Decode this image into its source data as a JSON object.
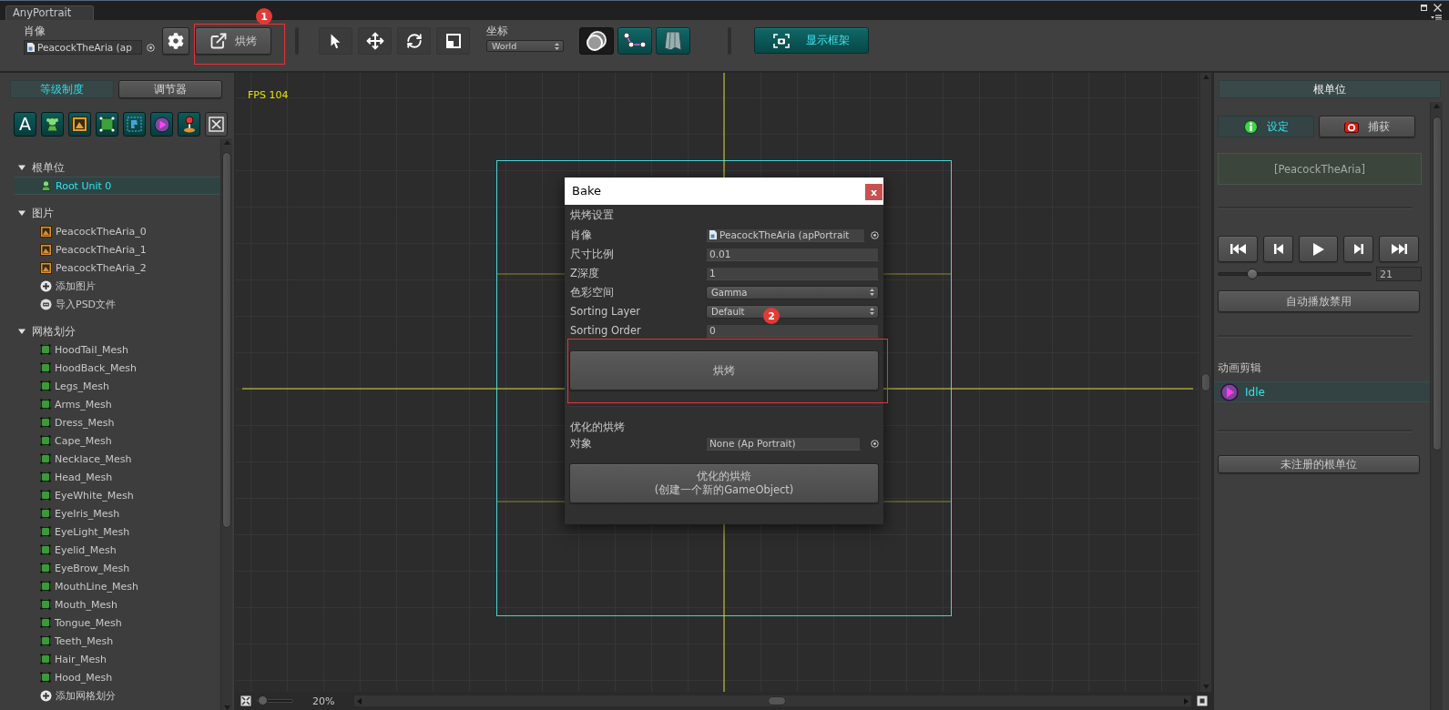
{
  "window": {
    "tab": "AnyPortrait"
  },
  "toolbar": {
    "portrait_label": "肖像",
    "portrait_value": "PeacockTheAria (ap",
    "bake_button": {
      "label": "烘烤",
      "annotation": "1"
    },
    "tools": [
      {
        "kind": "select"
      },
      {
        "kind": "move"
      },
      {
        "kind": "rotate"
      },
      {
        "kind": "scale"
      }
    ],
    "coordinate_label": "坐标",
    "coordinate_value": "World",
    "toggles": [
      {
        "kind": "onion",
        "on": false
      },
      {
        "kind": "bone",
        "on": true
      },
      {
        "kind": "mesh",
        "on": true
      }
    ],
    "frame_button": {
      "label": "显示框架",
      "on": true
    }
  },
  "left_panel": {
    "tabs": [
      {
        "label": "等级制度",
        "selected": true
      },
      {
        "label": "调节器",
        "selected": false
      }
    ],
    "filters": [
      {
        "kind": "text",
        "glyph": "A"
      },
      {
        "kind": "root-unit"
      },
      {
        "kind": "image"
      },
      {
        "kind": "mesh"
      },
      {
        "kind": "mesh-group"
      },
      {
        "kind": "animation"
      },
      {
        "kind": "param"
      },
      {
        "kind": "clear"
      }
    ],
    "tree": [
      {
        "label": "根单位",
        "expanded": true,
        "children": [
          {
            "label": "Root Unit 0",
            "kind": "root-unit",
            "selected": true
          }
        ]
      },
      {
        "label": "图片",
        "expanded": true,
        "children": [
          {
            "label": "PeacockTheAria_0",
            "kind": "image",
            "selected": false
          },
          {
            "label": "PeacockTheAria_1",
            "kind": "image",
            "selected": false
          },
          {
            "label": "PeacockTheAria_2",
            "kind": "image",
            "selected": false
          },
          {
            "label": "添加图片",
            "kind": "add",
            "selected": false
          },
          {
            "label": "导入PSD文件",
            "kind": "psd",
            "selected": false
          }
        ]
      },
      {
        "label": "网格划分",
        "expanded": true,
        "children": [
          {
            "label": "HoodTail_Mesh",
            "kind": "mesh",
            "selected": false
          },
          {
            "label": "HoodBack_Mesh",
            "kind": "mesh",
            "selected": false
          },
          {
            "label": "Legs_Mesh",
            "kind": "mesh",
            "selected": false
          },
          {
            "label": "Arms_Mesh",
            "kind": "mesh",
            "selected": false
          },
          {
            "label": "Dress_Mesh",
            "kind": "mesh",
            "selected": false
          },
          {
            "label": "Cape_Mesh",
            "kind": "mesh",
            "selected": false
          },
          {
            "label": "Necklace_Mesh",
            "kind": "mesh",
            "selected": false
          },
          {
            "label": "Head_Mesh",
            "kind": "mesh",
            "selected": false
          },
          {
            "label": "EyeWhite_Mesh",
            "kind": "mesh",
            "selected": false
          },
          {
            "label": "EyeIris_Mesh",
            "kind": "mesh",
            "selected": false
          },
          {
            "label": "EyeLight_Mesh",
            "kind": "mesh",
            "selected": false
          },
          {
            "label": "Eyelid_Mesh",
            "kind": "mesh",
            "selected": false
          },
          {
            "label": "EyeBrow_Mesh",
            "kind": "mesh",
            "selected": false
          },
          {
            "label": "MouthLine_Mesh",
            "kind": "mesh",
            "selected": false
          },
          {
            "label": "Mouth_Mesh",
            "kind": "mesh",
            "selected": false
          },
          {
            "label": "Tongue_Mesh",
            "kind": "mesh",
            "selected": false
          },
          {
            "label": "Teeth_Mesh",
            "kind": "mesh",
            "selected": false
          },
          {
            "label": "Hair_Mesh",
            "kind": "mesh",
            "selected": false
          },
          {
            "label": "Hood_Mesh",
            "kind": "mesh",
            "selected": false
          },
          {
            "label": "添加网格划分",
            "kind": "add",
            "selected": false
          }
        ]
      }
    ]
  },
  "canvas": {
    "fps": "FPS 104",
    "zoom_slider": {
      "level": 0.05
    },
    "zoom": "20%"
  },
  "bake_dialog": {
    "title": "Bake",
    "close": "x",
    "section": "烘烤设置",
    "fields": [
      {
        "label": "肖像",
        "kind": "object",
        "value": "PeacockTheAria (apPortrait"
      },
      {
        "label": "尺寸比例",
        "kind": "number",
        "value": "0.01"
      },
      {
        "label": "Z深度",
        "kind": "number",
        "value": "1"
      },
      {
        "label": "色彩空间",
        "kind": "dropdown",
        "value": "Gamma"
      },
      {
        "label": "Sorting Layer",
        "kind": "dropdown",
        "value": "Default"
      },
      {
        "label": "Sorting Order",
        "kind": "number",
        "value": "0"
      }
    ],
    "bake_button": {
      "label": "烘烤",
      "annotation": "2"
    },
    "optimized_section": "优化的烘烤",
    "target": {
      "label": "对象",
      "value": "None (Ap Portrait)"
    },
    "optimized_button": {
      "lines": [
        "优化的烘焙",
        "(创建一个新的GameObject)"
      ]
    }
  },
  "right_panel": {
    "header": "根单位",
    "tabs": [
      {
        "label": "设定",
        "kind": "info",
        "selected": true
      },
      {
        "label": "捕获",
        "kind": "capture",
        "selected": false
      }
    ],
    "name": "[PeacockTheAria]",
    "playback": [
      {
        "kind": "first"
      },
      {
        "kind": "prev"
      },
      {
        "kind": "play"
      },
      {
        "kind": "next"
      },
      {
        "kind": "last"
      }
    ],
    "frame_slider": {
      "level": 0.22,
      "value": "21"
    },
    "autoplay_button": "自动播放禁用",
    "clips_label": "动画剪辑",
    "clips": [
      {
        "label": "Idle",
        "selected": true
      }
    ],
    "unregistered_button": "未注册的根单位"
  }
}
